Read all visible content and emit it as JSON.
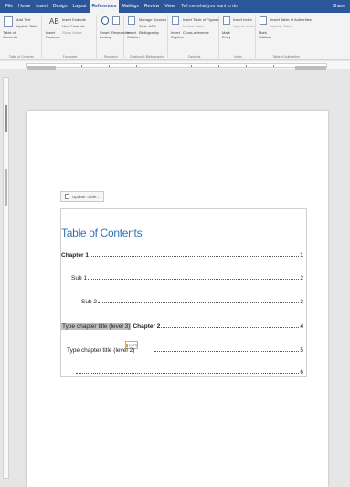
{
  "tabs": [
    "File",
    "Home",
    "Insert",
    "Design",
    "Layout",
    "References",
    "Mailings",
    "Review",
    "View"
  ],
  "active_tab": "References",
  "tell_me": "Tell me what you want to do",
  "share": "Share",
  "ribbon": {
    "toc_group": {
      "label": "Table of Contents",
      "toc_button": "Table of Contents",
      "add_text": "Add Text",
      "update_table": "Update Table"
    },
    "footnotes_group": {
      "label": "Footnotes",
      "insert_footnote": "Insert Footnote",
      "insert_endnote": "Insert Endnote",
      "next_footnote": "Next Footnote",
      "show_notes": "Show Notes",
      "ab": "AB"
    },
    "research_group": {
      "label": "Research",
      "smart_lookup": "Smart Lookup",
      "researcher": "Researcher"
    },
    "citations_group": {
      "label": "Citations & Bibliography",
      "insert_citation": "Insert Citation",
      "manage_sources": "Manage Sources",
      "style": "Style: APA",
      "bibliography": "Bibliography"
    },
    "captions_group": {
      "label": "Captions",
      "insert_caption": "Insert Caption",
      "insert_table_of_figures": "Insert Table of Figures",
      "update_table": "Update Table",
      "cross_reference": "Cross-reference"
    },
    "index_group": {
      "label": "Index",
      "mark_entry": "Mark Entry",
      "insert_index": "Insert Index",
      "update_index": "Update Index"
    },
    "authorities_group": {
      "label": "Table of Authorities",
      "mark_citation": "Mark Citation",
      "insert_toa": "Insert Table of Authorities",
      "update_table": "Update Table"
    }
  },
  "toc": {
    "handle_label": "Update Table...",
    "title": "Table of Contents",
    "entries": [
      {
        "text": "Chapter 1",
        "page": "1"
      },
      {
        "text": "Sub 1",
        "page": "2"
      },
      {
        "text": "Sub 2",
        "page": "3"
      },
      {
        "highlight": "Type chapter title (level 3)",
        "text": "Chapter 2",
        "page": "4"
      },
      {
        "text": "Type chapter title (level 2)",
        "page": "5"
      },
      {
        "text": "",
        "page": "6"
      }
    ],
    "paste_options": "(Ctrl)"
  }
}
